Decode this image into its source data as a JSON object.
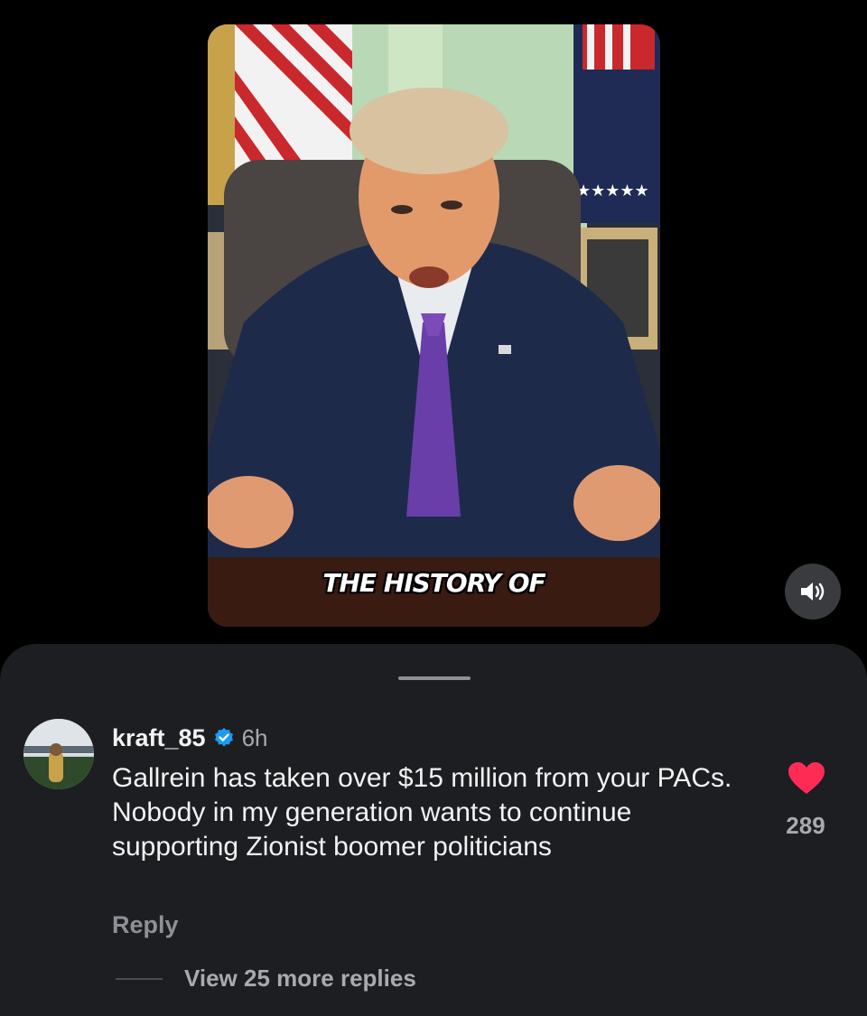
{
  "video": {
    "caption": "THE HISTORY OF",
    "mute_icon": "speaker-volume-icon"
  },
  "comment": {
    "username": "kraft_85",
    "verified_icon": "verified-badge-icon",
    "timestamp": "6h",
    "text": "Gallrein has taken over $15 million from your PACs. Nobody in my generation wants to continue supporting Zionist boomer politicians",
    "like_icon": "heart-icon",
    "like_color": "#fe2c55",
    "like_count": "289",
    "reply_label": "Reply",
    "view_replies_label": "View 25 more replies"
  },
  "colors": {
    "background": "#000000",
    "sheet": "#1c1e22",
    "verified": "#1d9bf0"
  }
}
